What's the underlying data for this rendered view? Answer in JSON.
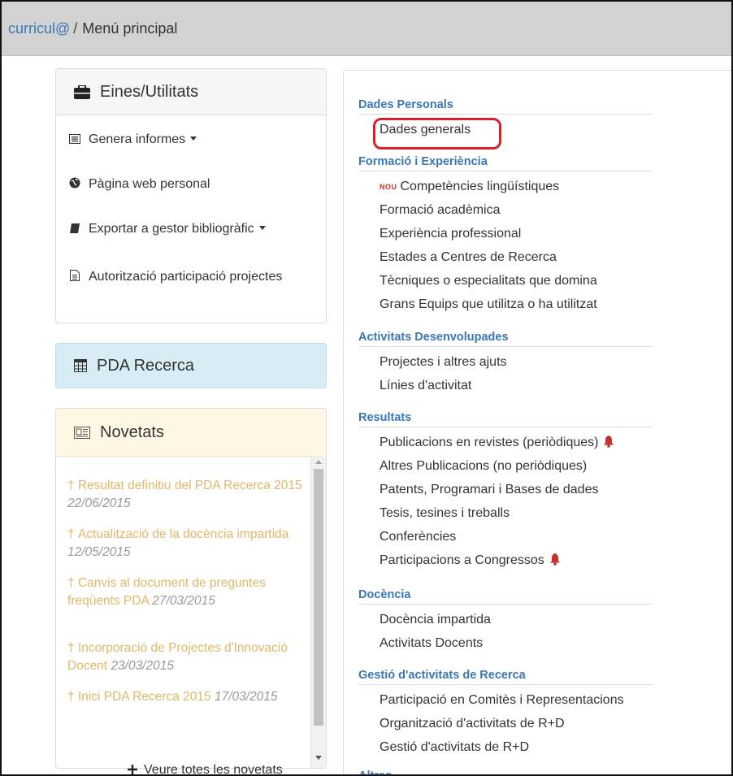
{
  "breadcrumb": {
    "home": "curricul@",
    "separator": "/",
    "current": "Menú principal"
  },
  "tools": {
    "title": "Eines/Utilitats",
    "items": [
      {
        "label": "Genera informes",
        "icon": "list-icon",
        "dropdown": true
      },
      {
        "label": "Pàgina web personal",
        "icon": "globe-icon",
        "dropdown": false
      },
      {
        "label": "Exportar a gestor bibliogràfic",
        "icon": "book-icon",
        "dropdown": true
      },
      {
        "label": "Autorització participació projectes",
        "icon": "document-icon",
        "dropdown": false
      }
    ]
  },
  "pda": {
    "title": "PDA Recerca"
  },
  "news": {
    "title": "Novetats",
    "items": [
      {
        "text": "Resultat definitiu del PDA Recerca 2015",
        "date": "22/06/2015"
      },
      {
        "text": "Actualització de la docència impartida",
        "date": "12/05/2015"
      },
      {
        "text": "Canvis al document de preguntes freqüents PDA",
        "date": "27/03/2015"
      },
      {
        "text": "Incorporació de Projectes d'Innovació Docent",
        "date": "23/03/2015"
      },
      {
        "text": "Inici PDA Recerca 2015",
        "date": "17/03/2015"
      }
    ],
    "more": "Veure totes les novetats"
  },
  "menu": {
    "sections": [
      {
        "title": "Dades Personals",
        "items": [
          "Dades generals"
        ]
      },
      {
        "title": "Formació i Experiència",
        "items": [
          "Competències lingüístiques",
          "Formació acadèmica",
          "Experiència professional",
          "Estades a Centres de Recerca",
          "Tècniques o especialitats que domina",
          "Grans Equips que utilitza o ha utilitzat"
        ]
      },
      {
        "title": "Activitats Desenvolupades",
        "items": [
          "Projectes i altres ajuts",
          "Línies d'activitat"
        ]
      },
      {
        "title": "Resultats",
        "items": [
          "Publicacions en revistes (periòdiques)",
          "Altres Publicacions (no periòdiques)",
          "Patents, Programari i Bases de dades",
          "Tesis, tesines i treballs",
          "Conferències",
          "Participacions a Congressos"
        ]
      },
      {
        "title": "Docència",
        "items": [
          "Docència impartida",
          "Activitats Docents"
        ]
      },
      {
        "title": "Gestió d'activitats de Recerca",
        "items": [
          "Participació en Comitès i Representacions",
          "Organització d'activitats de R+D",
          "Gestió d'activitats de R+D"
        ]
      },
      {
        "title": "Altres",
        "items": []
      }
    ],
    "new_badge": "NOU",
    "highlighted_item": "Dades generals"
  },
  "colors": {
    "link_blue": "#3a77b5",
    "news_orange": "#e3b768",
    "highlight_red": "#d9202a",
    "bell_red": "#c9302c",
    "pda_bg": "#d8ecf6"
  }
}
